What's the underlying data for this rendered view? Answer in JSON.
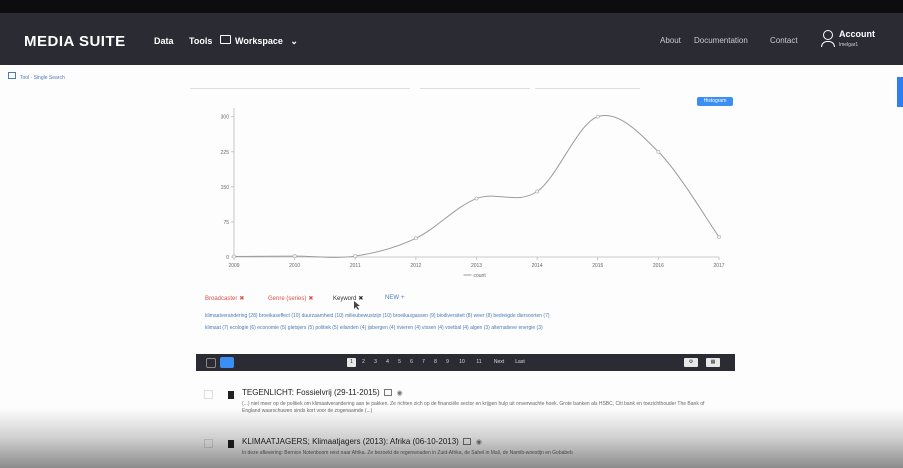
{
  "navbar": {
    "brand": "MEDIA SUITE",
    "links": [
      "Data",
      "Tools",
      "Workspace"
    ],
    "right_links": [
      "About",
      "Documentation",
      "Contact"
    ],
    "account_label": "Account",
    "account_user": "lmelgar1"
  },
  "breadcrumb": "Tool · Single Search",
  "histogram_button": "Histogram",
  "chart_data": {
    "type": "line",
    "x": [
      2009,
      2010,
      2011,
      2012,
      2013,
      2014,
      2015,
      2016,
      2017
    ],
    "series": [
      {
        "name": "count",
        "values": [
          1,
          2,
          2,
          40,
          125,
          140,
          300,
          225,
          43
        ]
      }
    ],
    "ylim": [
      0,
      310
    ],
    "yticks": [
      0,
      75,
      150,
      225,
      300
    ],
    "xticks": [
      "2009",
      "2010",
      "2011",
      "2012",
      "2013",
      "2014",
      "2015",
      "2016",
      "2017"
    ],
    "legend": "count",
    "grid": false
  },
  "filters": [
    {
      "label": "Broadcaster",
      "color": "#d9534f"
    },
    {
      "label": "Genre (series)",
      "color": "#d9534f"
    },
    {
      "label": "Keyword",
      "color": "#333333"
    },
    {
      "label": "NEW",
      "color": "#4a7bb8"
    }
  ],
  "keywords_line1": "klimaatverandering (28)  broeikaseffect (10)  duurzaamheid (10)  milieubewustzijn (10)  broeikasgassen (9)  biodiversiteit (8)  weer (8)  bedreigde diersoorten (7)",
  "keywords_line2": "klimaat (7)  ecologie (6)  economie (5)  gletsjers (5)  politiek (5)  eilanden (4)  ijsbergen (4)  rivieren (4)  vissen (4)  voetbal (4)  algen (3)  alternatieve energie (3)",
  "pagination": {
    "pages": [
      "1",
      "2",
      "3",
      "4",
      "5",
      "6",
      "7",
      "8",
      "9",
      "10",
      "11"
    ],
    "next": "Next",
    "last": "Last"
  },
  "results": [
    {
      "title": "TEGENLICHT: Fossielvrij (29-11-2015)",
      "snippet": "(...) niet meer op de politiek om klimaatverandering aan te pakken. Ze richten zich op de financiële sector en krijgen hulp uit onverwachte hoek. Grote banken als HSBC, Citi bank en toezichthouder The Bank of England waarschuwen sinds kort voor de zogenaamde (...)"
    },
    {
      "title": "KLIMAATJAGERS; Klimaatjagers (2013): Afrika (06-10-2013)",
      "snippet": "In deze aflevering: Bernice Notenboom reist naar Afrika. Ze bezoekt de regenwouden in Zuid-Afrika, de Sahel in Mali, de Namib-woestijn en Gobabeb"
    }
  ]
}
